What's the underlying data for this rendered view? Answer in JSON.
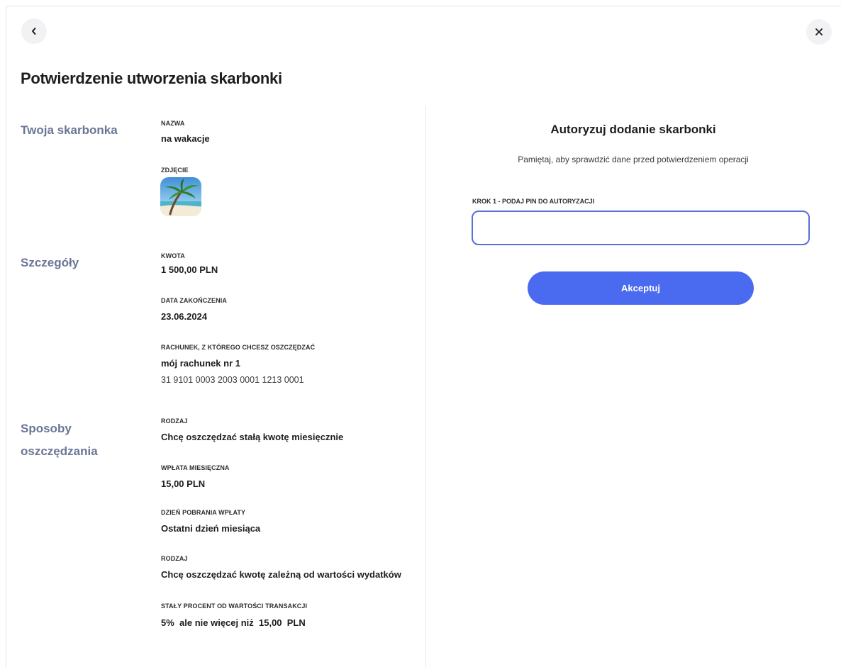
{
  "page_title": "Potwierdzenie utworzenia skarbonki",
  "sections": {
    "piggy": {
      "title": "Twoja skarbonka",
      "name_label": "NAZWA",
      "name_value": "na wakacje",
      "photo_label": "ZDJĘCIE"
    },
    "details": {
      "title": "Szczegóły",
      "amount_label": "KWOTA",
      "amount_value": "1 500,00 PLN",
      "end_date_label": "DATA ZAKOŃCZENIA",
      "end_date_value": "23.06.2024",
      "account_label": "RACHUNEK, Z KTÓREGO CHCESZ OSZCZĘDZAĆ",
      "account_name": "mój rachunek nr 1",
      "account_number": "31 9101 0003 2003 0001 1213 0001"
    },
    "saving": {
      "title_line1": "Sposoby",
      "title_line2": "oszczędzania",
      "type1_label": "RODZAJ",
      "type1_value": "Chcę oszczędzać stałą kwotę miesięcznie",
      "monthly_label": "WPŁATA MIESIĘCZNA",
      "monthly_value": "15,00 PLN",
      "day_label": "DZIEŃ POBRANIA WPŁATY",
      "day_value": "Ostatni dzień miesiąca",
      "type2_label": "RODZAJ",
      "type2_value": "Chcę oszczędzać kwotę zależną od wartości wydatków",
      "percent_label": "STAŁY PROCENT OD WARTOŚCI TRANSAKCJI",
      "percent_value": "5%  ale nie więcej niż  15,00  PLN"
    }
  },
  "auth": {
    "title": "Autoryzuj dodanie skarbonki",
    "note": "Pamiętaj, aby sprawdzić dane przed potwierdzeniem operacji",
    "pin_label": "KROK 1 - PODAJ PIN DO AUTORYZACJI",
    "pin_value": "",
    "accept_label": "Akceptuj"
  },
  "icons": {
    "back": "chevron-left-icon",
    "close": "close-icon"
  },
  "colors": {
    "accent": "#4a6bef",
    "section_title": "#6b7596",
    "input_border": "#5a6fd8"
  }
}
